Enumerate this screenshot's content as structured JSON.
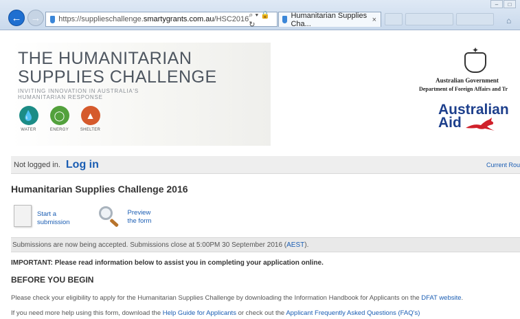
{
  "browser": {
    "url_prefix": "https://supplieschallenge.",
    "url_host": "smartygrants.com.au",
    "url_path": "/HSC2016",
    "address_tools": "⌕ ▾ 🔒 ↻",
    "tab_title": "Humanitarian Supplies Cha...",
    "tab_close": "×"
  },
  "header": {
    "title_line1": "THE HUMANITARIAN",
    "title_line2": "SUPPLIES CHALLENGE",
    "subtitle": "INVITING INNOVATION IN AUSTRALIA'S HUMANITARIAN RESPONSE",
    "categories": [
      {
        "label": "WATER",
        "icon": "water-drop-icon"
      },
      {
        "label": "ENERGY",
        "icon": "lightbulb-icon"
      },
      {
        "label": "SHELTER",
        "icon": "tent-icon"
      }
    ],
    "gov_name": "Australian Government",
    "gov_dept": "Department of Foreign Affairs and Tr",
    "aid_line1": "Australian",
    "aid_line2": "Aid"
  },
  "loginbar": {
    "not_logged": "Not logged in.",
    "login": "Log in",
    "current_round": "Current Rou"
  },
  "page_title": "Humanitarian Supplies Challenge 2016",
  "actions": {
    "start_line1": "Start a",
    "start_line2": "submission",
    "preview_line1": "Preview",
    "preview_line2": "the form"
  },
  "notice": {
    "text": "Submissions are now being accepted. Submissions close at 5:00PM 30 September 2016 (",
    "link": "AEST",
    "end": ")."
  },
  "important": "IMPORTANT: Please read information below to assist you in completing your application online.",
  "before_heading": "BEFORE YOU BEGIN",
  "para1": {
    "text": "Please check your eligibility to apply for the Humanitarian Supplies Challenge by downloading the Information Handbook for Applicants on the ",
    "link": "DFAT website",
    "end": "."
  },
  "para2": {
    "text": "If you need more help using this form, download the ",
    "link1": "Help Guide for Applicants",
    "mid": " or check out the ",
    "link2": "Applicant Frequently Asked Questions (FAQ's)"
  },
  "colors": {
    "link": "#1a5db3",
    "water": "#1c8c86",
    "energy": "#53a13c",
    "shelter": "#d55a2c",
    "kangaroo": "#d0202a",
    "aid_blue": "#1d3f8c"
  }
}
